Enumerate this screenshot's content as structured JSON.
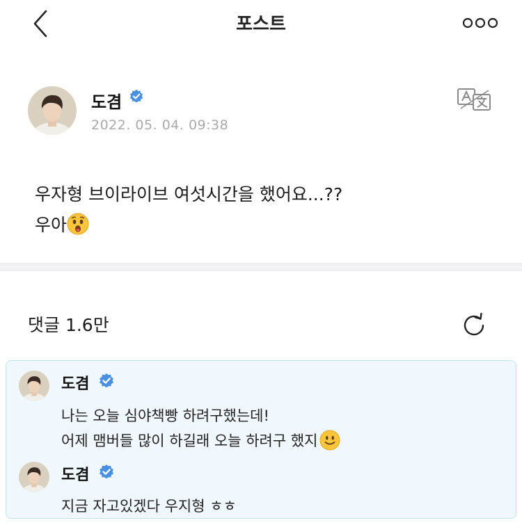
{
  "header": {
    "title": "포스트"
  },
  "post": {
    "author": "도겸",
    "date": "2022. 05. 04. 09:38",
    "text_line1": "우자형 브이라이브 여섯시간을 했어요...??",
    "text_line2": "우아"
  },
  "comments": {
    "label": "댓글 1.6만",
    "items": [
      {
        "author": "도겸",
        "line1": "나는 오늘 심야책빵 하려구했는데!",
        "line2": "어제 맴버들 많이 하길래 오늘 하려구 했지"
      },
      {
        "author": "도겸",
        "line1": "지금 자고있겠다 우지형 ㅎㅎ"
      }
    ]
  },
  "colors": {
    "verified": "#4a90e2",
    "highlight_bg": "#f0f8fd",
    "highlight_border": "#c6e3f3",
    "date": "#a9a9a9"
  },
  "icons": [
    "back-icon",
    "more-icon",
    "verified-icon",
    "translate-icon",
    "refresh-icon",
    "surprised-emoji",
    "smile-emoji"
  ]
}
